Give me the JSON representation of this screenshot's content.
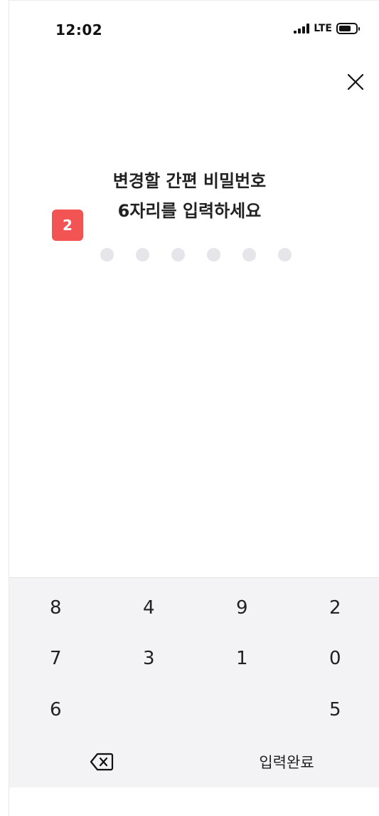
{
  "status_bar": {
    "time": "12:02",
    "network": "LTE",
    "battery_level": 0.65,
    "signal_bars": 3
  },
  "header": {
    "close_icon": "close-icon"
  },
  "prompt": {
    "line1": "변경할 간편 비밀번호",
    "line2": "6자리를 입력하세요",
    "step_badge": "2"
  },
  "pin": {
    "length": 6,
    "filled": 0
  },
  "keypad": {
    "rows": [
      [
        "8",
        "4",
        "9",
        "2"
      ],
      [
        "7",
        "3",
        "1",
        "0"
      ],
      [
        "6",
        "",
        "",
        "5"
      ]
    ],
    "backspace_icon": "backspace-icon",
    "submit_label": "입력완료"
  }
}
